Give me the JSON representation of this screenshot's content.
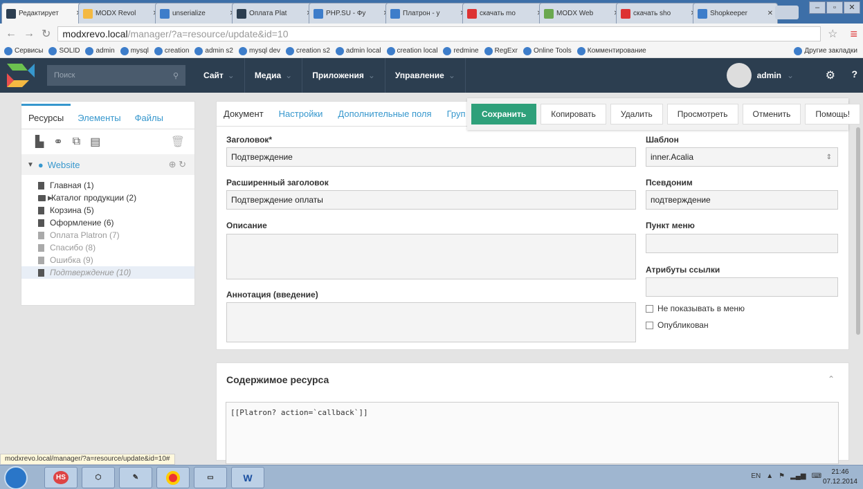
{
  "browser": {
    "tabs": [
      {
        "title": "Редактирует",
        "color": "#2c3e50"
      },
      {
        "title": "MODX Revol",
        "color": "#f4b942"
      },
      {
        "title": "unserialize",
        "color": "#3d7dca"
      },
      {
        "title": "Оплата Plat",
        "color": "#2c3e50"
      },
      {
        "title": "PHP.SU - Фу",
        "color": "#3d7dca"
      },
      {
        "title": "Платрон - у",
        "color": "#3d7dca"
      },
      {
        "title": "скачать mo",
        "color": "#d33"
      },
      {
        "title": "MODX Web",
        "color": "#6aa84f"
      },
      {
        "title": "скачать sho",
        "color": "#d33"
      },
      {
        "title": "Shopkeeper",
        "color": "#3d7dca"
      }
    ],
    "url_host": "modxrevo.local",
    "url_path": "/manager/?a=resource/update&id=10",
    "bookmarks": [
      "Сервисы",
      "SOLID",
      "admin",
      "mysql",
      "creation",
      "admin s2",
      "mysql dev",
      "creation s2",
      "admin local",
      "creation local",
      "redmine",
      "RegExr",
      "Online Tools",
      "Комментирование",
      "Другие закладки"
    ],
    "status_url": "modxrevo.local/manager/?a=resource/update&id=10#"
  },
  "header": {
    "search_placeholder": "Поиск",
    "nav": [
      "Сайт",
      "Медиа",
      "Приложения",
      "Управление"
    ],
    "user": "admin"
  },
  "left": {
    "tabs": [
      "Ресурсы",
      "Элементы",
      "Файлы"
    ],
    "root": "Website",
    "tree": [
      {
        "label": "Главная (1)",
        "state": "normal"
      },
      {
        "label": "Каталог продукции (2)",
        "state": "folder"
      },
      {
        "label": "Корзина (5)",
        "state": "normal"
      },
      {
        "label": "Оформление (6)",
        "state": "normal"
      },
      {
        "label": "Оплата Platron (7)",
        "state": "grey"
      },
      {
        "label": "Спасибо (8)",
        "state": "grey"
      },
      {
        "label": "Ошибка (9)",
        "state": "grey"
      },
      {
        "label": "Подтверждение (10)",
        "state": "selected"
      }
    ]
  },
  "form": {
    "tabs": [
      "Документ",
      "Настройки",
      "Дополнительные поля",
      "Груп"
    ],
    "actions": [
      "Сохранить",
      "Копировать",
      "Удалить",
      "Просмотреть",
      "Отменить",
      "Помощь!"
    ],
    "title_label": "Заголовок*",
    "title_value": "Подтверждение",
    "longtitle_label": "Расширенный заголовок",
    "longtitle_value": "Подтверждение оплаты",
    "description_label": "Описание",
    "introtext_label": "Аннотация (введение)",
    "template_label": "Шаблон",
    "template_value": "inner.Acalia",
    "alias_label": "Псевдоним",
    "alias_value": "подтверждение",
    "menutitle_label": "Пункт меню",
    "linkattr_label": "Атрибуты ссылки",
    "hidemenu_label": "Не показывать в меню",
    "published_label": "Опубликован"
  },
  "content": {
    "title": "Содержимое ресурса",
    "code": "[[Platron? action=`callback`]]"
  },
  "taskbar": {
    "lang": "EN",
    "time": "21:46",
    "date": "07.12.2014"
  }
}
